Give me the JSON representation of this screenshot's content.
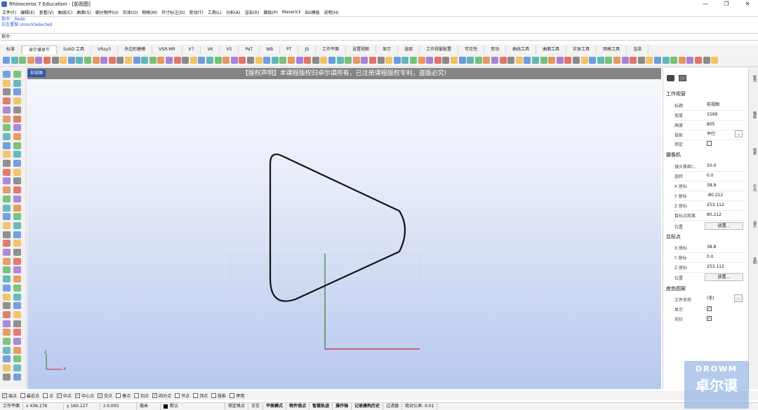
{
  "window": {
    "title": "Rhinoceros 7 Education - [前视图]",
    "controls": [
      "—",
      "❐",
      "✕"
    ]
  },
  "menu": [
    "文件(F)",
    "编辑(E)",
    "查看(V)",
    "曲线(C)",
    "曲面(S)",
    "细分物件(U)",
    "实体(O)",
    "网格(M)",
    "尺寸标注(D)",
    "变动(T)",
    "工具(L)",
    "分析(A)",
    "渲染(R)",
    "面板(P)",
    "Maverick",
    "BG模板",
    "说明(H)"
  ],
  "command_history": [
    "指令: _Redo",
    "正在重做 UnlockSelected"
  ],
  "command_prompt": "指令:",
  "tabs": [
    "标准",
    "卓尔谟显牛",
    "SubD 工具",
    "VRay5",
    "多边形建模",
    "VSR-MR",
    "V7",
    "V6",
    "V5",
    "PeT",
    "WB",
    "PT",
    "JS",
    "工作平面",
    "设置视图",
    "显示",
    "选取",
    "工作视窗配置",
    "可见性",
    "变动",
    "曲线工具",
    "曲面工具",
    "实体工具",
    "网格工具",
    "渲染"
  ],
  "active_tab": "卓尔谟显牛",
  "viewport": {
    "label": "前视图",
    "banner": "【版权声明】本课程版权归卓尔谟所有，已注册课程版权专利，盗版必究!",
    "axis_z": "z",
    "axis_x": "x"
  },
  "panel": {
    "section_viewport": "工作视窗",
    "rows_viewport": [
      {
        "label": "标题",
        "value": "前视图"
      },
      {
        "label": "宽度",
        "value": "1599"
      },
      {
        "label": "高度",
        "value": "805"
      },
      {
        "label": "投影",
        "value": "平行"
      }
    ],
    "lock_label": "锁定",
    "section_camera": "摄像机",
    "rows_camera": [
      {
        "label": "镜头焦距(...",
        "value": "50.0"
      },
      {
        "label": "旋转",
        "value": "0.0"
      },
      {
        "label": "X 座标",
        "value": "58.8"
      },
      {
        "label": "Y 座标",
        "value": "-80.212"
      },
      {
        "label": "Z 座标",
        "value": "253.112"
      },
      {
        "label": "目标点距离",
        "value": "80.212"
      }
    ],
    "position_label": "位置",
    "place_button": "放置...",
    "section_target": "目标点",
    "rows_target": [
      {
        "label": "X 座标",
        "value": "38.8"
      },
      {
        "label": "Y 座标",
        "value": "0.0"
      },
      {
        "label": "Z 座标",
        "value": "253.112"
      }
    ],
    "section_background": "底色图案",
    "file_label": "文件名称",
    "file_value": "(无)",
    "browse_button": "...",
    "show_label": "显示",
    "gray_label": "灰阶"
  },
  "right_strip": [
    "属性",
    "图层",
    "材质",
    "灯光",
    "显示",
    "说明"
  ],
  "osnaps": [
    {
      "label": "端点",
      "checked": true
    },
    {
      "label": "最近点",
      "checked": false
    },
    {
      "label": "点",
      "checked": false
    },
    {
      "label": "中点",
      "checked": true
    },
    {
      "label": "中心点",
      "checked": true
    },
    {
      "label": "交点",
      "checked": true
    },
    {
      "label": "垂点",
      "checked": false
    },
    {
      "label": "切点",
      "checked": false
    },
    {
      "label": "四分点",
      "checked": true
    },
    {
      "label": "节点",
      "checked": false
    },
    {
      "label": "顶点",
      "checked": false
    },
    {
      "label": "投影",
      "checked": false
    },
    {
      "label": "停用",
      "checked": false
    }
  ],
  "status": {
    "cplane": "工作平面",
    "x": "x 436.176",
    "y": "y 160.127",
    "z": "z 0.000",
    "unit": "毫米",
    "layer": "默认",
    "toggles": [
      "锁定格点",
      "正交",
      "平面模式",
      "物件锁点",
      "智慧轨迹",
      "操作轴",
      "记录建构历史",
      "过滤器"
    ],
    "tolerance": "绝对公差: 0.01"
  },
  "watermark": {
    "line1": "DROWM",
    "line2": "卓尔谟"
  },
  "colors": {
    "accent": "#2e58a6",
    "grid_x": "#c62828",
    "grid_y": "#2e7d32",
    "curve": "#111111"
  }
}
